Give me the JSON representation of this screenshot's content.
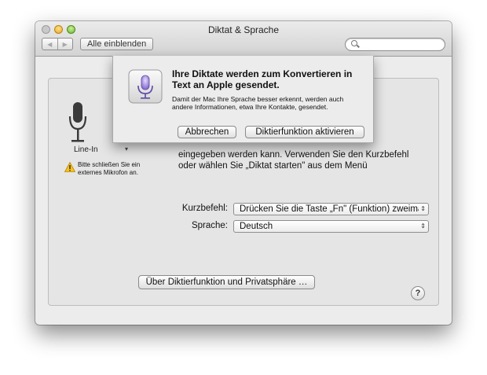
{
  "window": {
    "title": "Diktat & Sprache"
  },
  "toolbar": {
    "back_glyph": "◀",
    "forward_glyph": "▶",
    "show_all_label": "Alle einblenden",
    "search_placeholder": ""
  },
  "input_source": {
    "device_label": "Line-In",
    "device_caret": "▾",
    "warning_text": "Bitte schließen Sie ein externes Mikrofon an.",
    "mic_icon": "microphone-icon",
    "warning_icon": "warning-triangle-icon"
  },
  "description": {
    "visible_text": "eingegeben werden kann. Verwenden Sie den Kurzbefehl oder wählen Sie „Diktat starten\" aus dem Menü"
  },
  "settings": {
    "shortcut_label": "Kurzbefehl:",
    "shortcut_value": "Drücken Sie die Taste „Fn\" (Funktion) zweimal",
    "language_label": "Sprache:",
    "language_value": "Deutsch",
    "popup_arrows": "⇕"
  },
  "footer": {
    "privacy_button_label": "Über Diktierfunktion und Privatsphäre …",
    "help_button_label": "?"
  },
  "sheet": {
    "title": "Ihre Diktate werden zum Konvertieren in Text an Apple gesendet.",
    "body": "Damit der Mac Ihre Sprache besser erkennt, werden auch andere Informationen, etwa Ihre Kontakte, gesendet.",
    "cancel_label": "Abbrechen",
    "activate_label": "Diktierfunktion aktivieren",
    "icon": "siri-microphone-icon"
  },
  "colors": {
    "window_bg": "#ececec",
    "panel_bg": "#e5e5e5",
    "siri_purple": "#8a6fd1",
    "warning_yellow": "#f7c21b"
  }
}
